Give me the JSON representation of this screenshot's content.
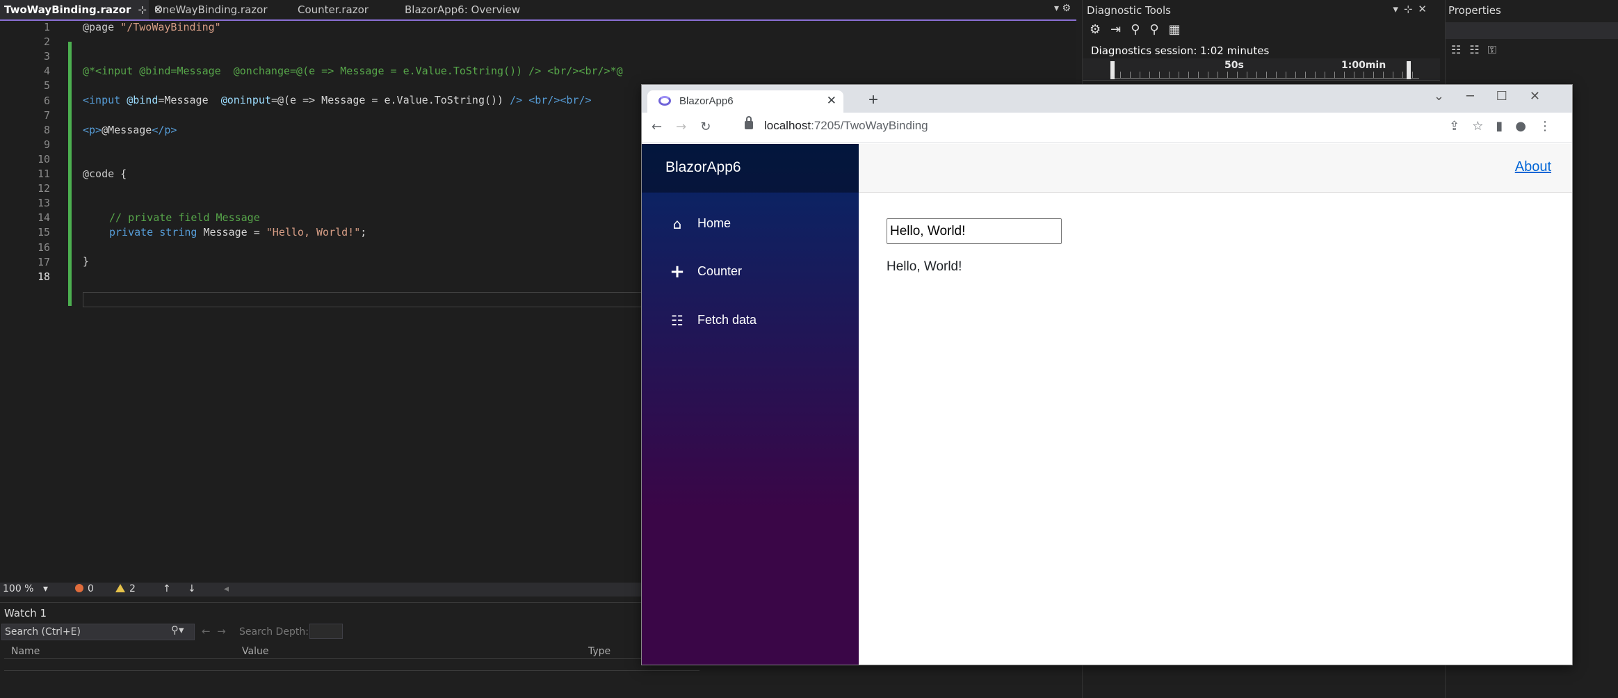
{
  "editor": {
    "tabs": [
      {
        "label": "TwoWayBinding.razor",
        "pin": "⊹",
        "close": "✕"
      },
      {
        "label": "OneWayBinding.razor"
      },
      {
        "label": "Counter.razor"
      },
      {
        "label": "BlazorApp6: Overview"
      }
    ],
    "line_numbers": [
      "1",
      "2",
      "3",
      "4",
      "5",
      "6",
      "7",
      "8",
      "9",
      "10",
      "11",
      "12",
      "13",
      "14",
      "15",
      "16",
      "17",
      "18"
    ],
    "lines": {
      "l1_dir": "@page",
      "l1_str": " \"/TwoWayBinding\"",
      "l4": "@*<input @bind=Message  @onchange=@(e => Message = e.Value.ToString()) /> <br/><br/>*@",
      "l6_tag": "<input",
      "l6_att1": " @bind",
      "l6_eq1": "=Message  ",
      "l6_att2": "@oninput",
      "l6_rest": "=@(e => Message = e.Value.ToString())",
      "l6_end": " /> <br/><br/>",
      "l8_open": "<p>",
      "l8_mid": "@Message",
      "l8_close": "</p>",
      "l11_at": "@code",
      "l11_brace": " {",
      "l14": "// private field Message",
      "l15_kw1": "private",
      "l15_kw2": " string",
      "l15_txt": " Message = ",
      "l15_str": "\"Hello, World!\"",
      "l15_end": ";",
      "l17": "}"
    }
  },
  "status": {
    "zoom": "100 %",
    "errors": "0",
    "warnings": "2"
  },
  "watch": {
    "title": "Watch 1",
    "search_placeholder": "Search (Ctrl+E)",
    "search_depth_label": "Search Depth:",
    "columns": [
      "Name",
      "Value",
      "Type"
    ]
  },
  "diagnostics": {
    "title": "Diagnostic Tools",
    "session": "Diagnostics session: 1:02 minutes",
    "ticks": [
      "50s",
      "1:00min"
    ]
  },
  "properties": {
    "title": "Properties"
  },
  "browser": {
    "tab_title": "BlazorApp6",
    "url_host": "localhost",
    "url_path": ":7205/TwoWayBinding",
    "app": {
      "brand": "BlazorApp6",
      "about": "About",
      "nav": [
        {
          "label": "Home",
          "icon": "home-icon"
        },
        {
          "label": "Counter",
          "icon": "plus-icon"
        },
        {
          "label": "Fetch data",
          "icon": "list-icon"
        }
      ],
      "input_value": "Hello, World!",
      "message": "Hello, World!"
    }
  },
  "colors": {
    "accent": "#8a6fd4",
    "sidebar_top": "#052767",
    "sidebar_bottom": "#3a0647",
    "link": "#0366d6"
  }
}
